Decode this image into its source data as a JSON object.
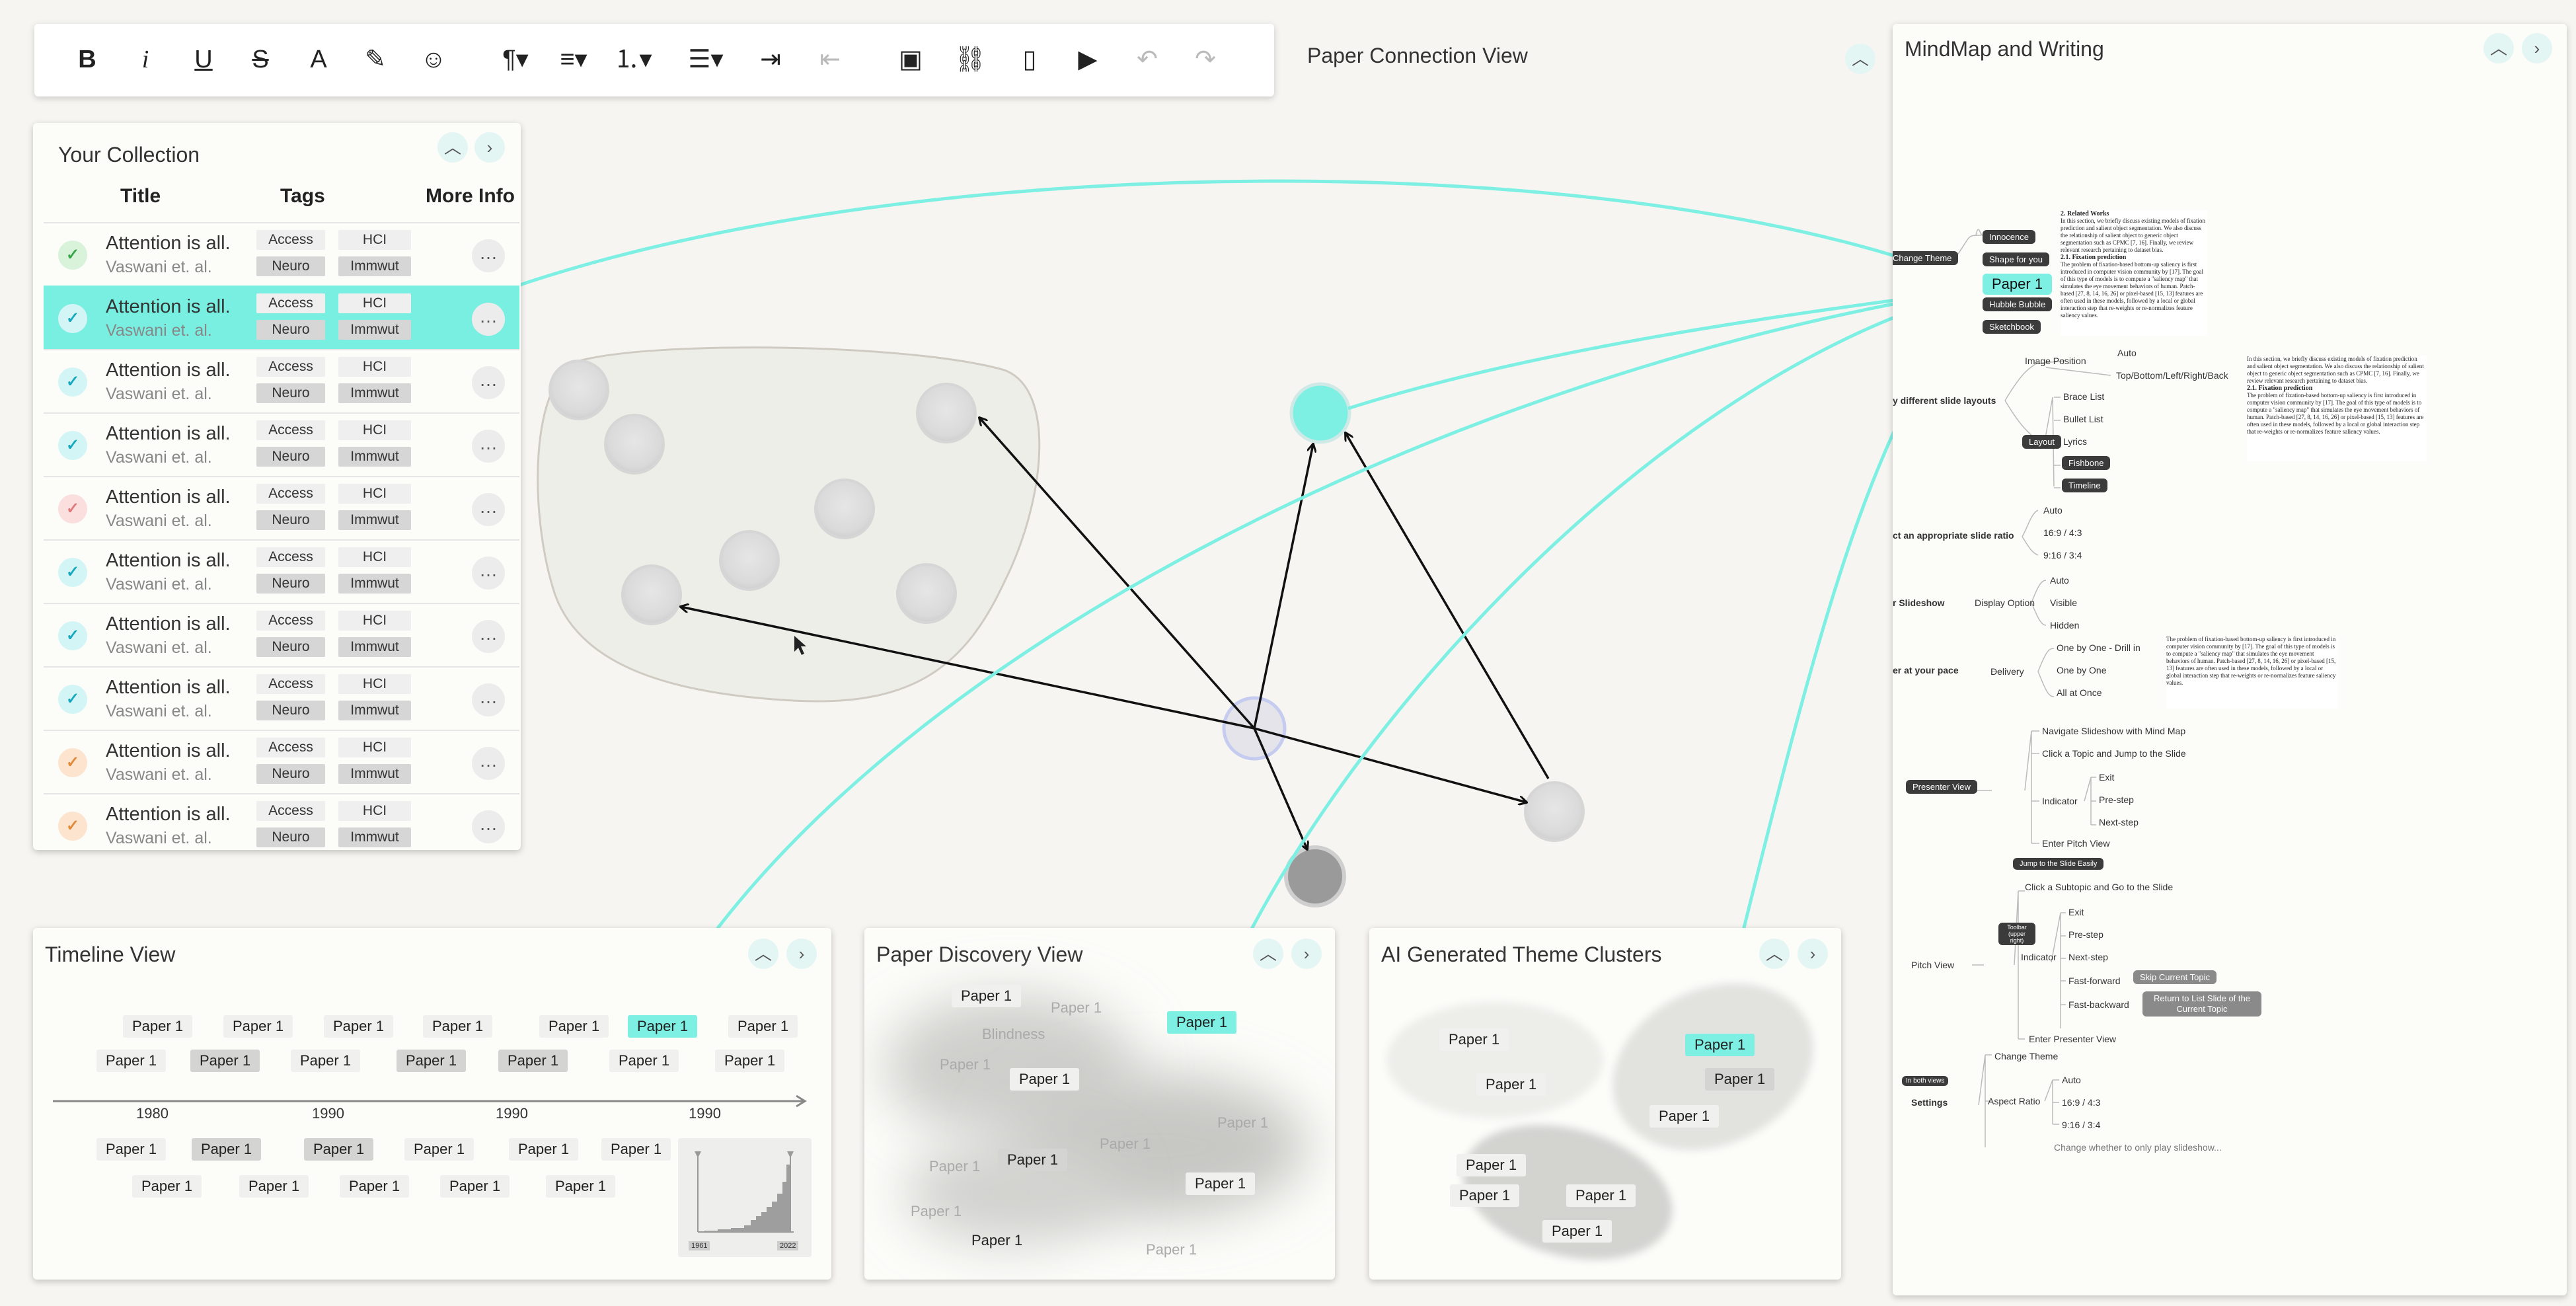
{
  "colors": {
    "accent": "#7ef0e3",
    "bg": "#f6f5f1",
    "panel": "#fcfcf9",
    "selected_row": "#79efe2",
    "edge": "#111111"
  },
  "toolbar": {
    "items": [
      {
        "icon": "bold-icon",
        "glyph": "B"
      },
      {
        "icon": "italic-icon",
        "glyph": "i"
      },
      {
        "icon": "underline-icon",
        "glyph": "U"
      },
      {
        "icon": "strikethrough-icon",
        "glyph": "S"
      },
      {
        "icon": "font-color-icon",
        "glyph": "A"
      },
      {
        "icon": "highlighter-icon",
        "glyph": "✎"
      },
      {
        "icon": "emoji-icon",
        "glyph": "☺"
      },
      {
        "icon": "paragraph-icon",
        "glyph": "¶▾"
      },
      {
        "icon": "align-icon",
        "glyph": "≡▾"
      },
      {
        "icon": "numbered-list-icon",
        "glyph": "⒈▾"
      },
      {
        "icon": "bullet-list-icon",
        "glyph": "☰▾"
      },
      {
        "icon": "indent-icon",
        "glyph": "⇥"
      },
      {
        "icon": "outdent-icon",
        "glyph": "⇤"
      },
      {
        "icon": "image-icon",
        "glyph": "▣"
      },
      {
        "icon": "link-icon",
        "glyph": "⛓"
      },
      {
        "icon": "file-icon",
        "glyph": "▯"
      },
      {
        "icon": "video-icon",
        "glyph": "▶"
      },
      {
        "icon": "undo-icon",
        "glyph": "↶"
      },
      {
        "icon": "redo-icon",
        "glyph": "↷"
      }
    ]
  },
  "collection": {
    "title": "Your Collection",
    "headers": {
      "title": "Title",
      "tags": "Tags",
      "more": "More Info"
    },
    "rows": [
      {
        "title": "Attention is all.",
        "author": "Vaswani et. al.",
        "tags": [
          "Access",
          "HCI",
          "Neuro",
          "Immwut"
        ],
        "status": "green",
        "more": "…"
      },
      {
        "title": "Attention is all.",
        "author": "Vaswani et. al.",
        "tags": [
          "Access",
          "HCI",
          "Neuro",
          "Immwut"
        ],
        "status": "teal",
        "more": "…"
      },
      {
        "title": "Attention is all.",
        "author": "Vaswani et. al.",
        "tags": [
          "Access",
          "HCI",
          "Neuro",
          "Immwut"
        ],
        "status": "teal",
        "more": "…"
      },
      {
        "title": "Attention is all.",
        "author": "Vaswani et. al.",
        "tags": [
          "Access",
          "HCI",
          "Neuro",
          "Immwut"
        ],
        "status": "teal",
        "more": "…"
      },
      {
        "title": "Attention is all.",
        "author": "Vaswani et. al.",
        "tags": [
          "Access",
          "HCI",
          "Neuro",
          "Immwut"
        ],
        "status": "red",
        "more": "…"
      },
      {
        "title": "Attention is all.",
        "author": "Vaswani et. al.",
        "tags": [
          "Access",
          "HCI",
          "Neuro",
          "Immwut"
        ],
        "status": "teal",
        "more": "…"
      },
      {
        "title": "Attention is all.",
        "author": "Vaswani et. al.",
        "tags": [
          "Access",
          "HCI",
          "Neuro",
          "Immwut"
        ],
        "status": "teal",
        "more": "…"
      },
      {
        "title": "Attention is all.",
        "author": "Vaswani et. al.",
        "tags": [
          "Access",
          "HCI",
          "Neuro",
          "Immwut"
        ],
        "status": "teal",
        "more": "…"
      },
      {
        "title": "Attention is all.",
        "author": "Vaswani et. al.",
        "tags": [
          "Access",
          "HCI",
          "Neuro",
          "Immwut"
        ],
        "status": "orange",
        "more": "…"
      },
      {
        "title": "Attention is all.",
        "author": "Vaswani et. al.",
        "tags": [
          "Access",
          "HCI",
          "Neuro",
          "Immwut"
        ],
        "status": "orange",
        "more": "…"
      }
    ]
  },
  "connection_view": {
    "title": "Paper Connection View"
  },
  "timeline": {
    "title": "Timeline View",
    "row1": [
      "Paper 1",
      "Paper 1",
      "Paper 1",
      "Paper 1",
      "Paper 1",
      "Paper 1",
      "Paper 1"
    ],
    "row2": [
      "Paper 1",
      "Paper 1",
      "Paper 1",
      "Paper 1",
      "Paper 1",
      "Paper 1",
      "Paper 1"
    ],
    "years": [
      "1980",
      "1990",
      "1990",
      "1990"
    ],
    "row3": [
      "Paper 1",
      "Paper 1",
      "Paper 1",
      "Paper 1",
      "Paper 1",
      "Paper 1"
    ],
    "row4": [
      "Paper 1",
      "Paper 1",
      "Paper 1",
      "Paper 1",
      "Paper 1"
    ],
    "histogram": {
      "start": "1961",
      "end": "2022"
    }
  },
  "discovery": {
    "title": "Paper Discovery View",
    "chips": [
      "Paper 1",
      "Paper 1",
      "Blindness",
      "Paper 1",
      "Paper 1",
      "Paper 1",
      "Paper 1",
      "Paper 1",
      "Paper 1",
      "Paper 1",
      "Paper 1",
      "Paper 1",
      "Paper 1",
      "Paper 1"
    ]
  },
  "themes": {
    "title": "AI Generated Theme Clusters",
    "chips": [
      "Paper 1",
      "Paper 1",
      "Paper 1",
      "Paper 1",
      "Paper 1",
      "Paper 1",
      "Paper 1",
      "Paper 1",
      "Paper 1"
    ]
  },
  "mindmap": {
    "title": "MindMap and Writing",
    "buttons": [
      "Innocence",
      "Shape for you",
      "Paper 1",
      "Hubble Bubble",
      "Sketchbook",
      "Change Theme"
    ],
    "labels": {
      "slide_layouts": "y different slide layouts",
      "image_position": "Image Position",
      "auto": "Auto",
      "tblr": "Top/Bottom/Left/Right/Back",
      "layout": "Layout",
      "brace_list": "Brace List",
      "bullet_list": "Bullet List",
      "lyrics": "Lyrics",
      "fishbone": "Fishbone",
      "timeline": "Timeline",
      "ratio": "ct an appropriate slide ratio",
      "ratio_auto": "Auto",
      "r169": "16:9 / 4:3",
      "r916": "9:16 / 3:4",
      "slideshow": "r Slideshow",
      "display_option": "Display Option",
      "d_auto": "Auto",
      "visible": "Visible",
      "hidden": "Hidden",
      "pace": "er at your pace",
      "delivery": "Delivery",
      "one_drill": "One by One - Drill in",
      "one_one": "One by One",
      "all_once": "All at Once",
      "presenter": "Presenter View",
      "navigate": "Navigate Slideshow with Mind Map",
      "click_topic": "Click a Topic and Jump to the Slide",
      "indicator": "Indicator",
      "exit": "Exit",
      "prestep": "Pre-step",
      "nextstep": "Next-step",
      "enter_pitch": "Enter Pitch View",
      "jump_easily": "Jump to the Slide Easily",
      "click_sub": "Click a Subtopic and Go to the Slide",
      "toolbar_upper": "Toolbar (upper right)",
      "pitch": "Pitch View",
      "indicator2": "Indicator",
      "exit2": "Exit",
      "prestep2": "Pre-step",
      "nextstep2": "Next-step",
      "ff": "Fast-forward",
      "skip": "Skip Current Topic",
      "fb": "Fast-backward",
      "return": "Return to List Slide of the Current Topic",
      "enter_presenter": "Enter Presenter View",
      "change_theme": "Change Theme",
      "in_both": "In both views",
      "settings": "Settings",
      "aspect": "Aspect Ratio",
      "a_auto": "Auto",
      "a169": "16:9 / 4:3",
      "a916": "9:16 / 3:4"
    },
    "doc": {
      "h1": "2. Related Works",
      "p1": "In this section, we briefly discuss existing models of fixation prediction and salient object segmentation. We also discuss the relationship of salient object to generic object segmentation such as CPMC [7, 16]. Finally, we review relevant research pertaining to dataset bias.",
      "h2": "2.1. Fixation prediction",
      "p2": "The problem of fixation-based bottom-up saliency is first introduced in computer vision community by [17]. The goal of this type of models is to compute a \"saliency map\" that simulates the eye movement behaviors of human. Patch-based [27, 8, 14, 16, 26] or pixel-based [15, 13] features are often used in these models, followed by a local or global interaction step that re-weights or re-normalizes feature saliency values.",
      "p3": "In this section, we briefly discuss existing models of fixation prediction and salient object segmentation. We also discuss the relationship of salient object to generic object segmentation such as CPMC [7, 16]. Finally, we review relevant research pertaining to dataset bias.",
      "h3": "2.1. Fixation prediction",
      "p4": "The problem of fixation-based bottom-up saliency is first introduced in computer vision community by [17]. The goal of this type of models is to compute a \"saliency map\" that simulates the eye movement behaviors of human. Patch-based [27, 8, 14, 16, 26] or pixel-based [15, 13] features are often used in these models, followed by a local or global interaction step that re-weights or re-normalizes feature saliency values.",
      "p5": "The problem of fixation-based bottom-up saliency is first introduced in computer vision community by [17]. The goal of this type of models is to compute a \"saliency map\" that simulates the eye movement behaviors of human. Patch-based [27, 8, 14, 16, 26] or pixel-based [15, 13] features are often used in these models, followed by a local or global interaction step that re-weights or re-normalizes feature saliency values.",
      "cut": "Change whether to only play slideshow..."
    }
  }
}
